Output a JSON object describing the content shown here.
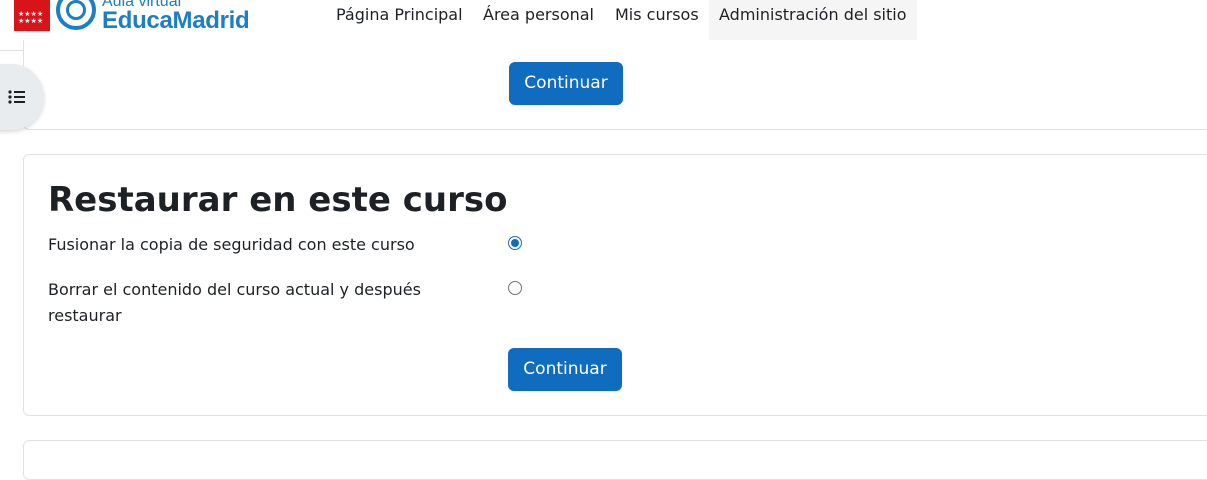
{
  "header": {
    "logo_subtitle": "Aula virtual",
    "logo_title": "EducaMadrid",
    "nav": [
      {
        "label": "Página Principal"
      },
      {
        "label": "Área personal"
      },
      {
        "label": "Mis cursos"
      },
      {
        "label": "Administración del sitio"
      }
    ],
    "flag_stars": "★★★★"
  },
  "top_card": {
    "continue_label": "Continuar"
  },
  "restore_section": {
    "title": "Restaurar en este curso",
    "options": [
      {
        "label": "Fusionar la copia de seguridad con este curso",
        "checked": true
      },
      {
        "label": "Borrar el contenido del curso actual y después restaurar",
        "checked": false
      }
    ],
    "continue_label": "Continuar"
  },
  "colors": {
    "primary": "#0f6cbf",
    "brand": "#1c7fc4",
    "flag_red": "#d7141a"
  }
}
